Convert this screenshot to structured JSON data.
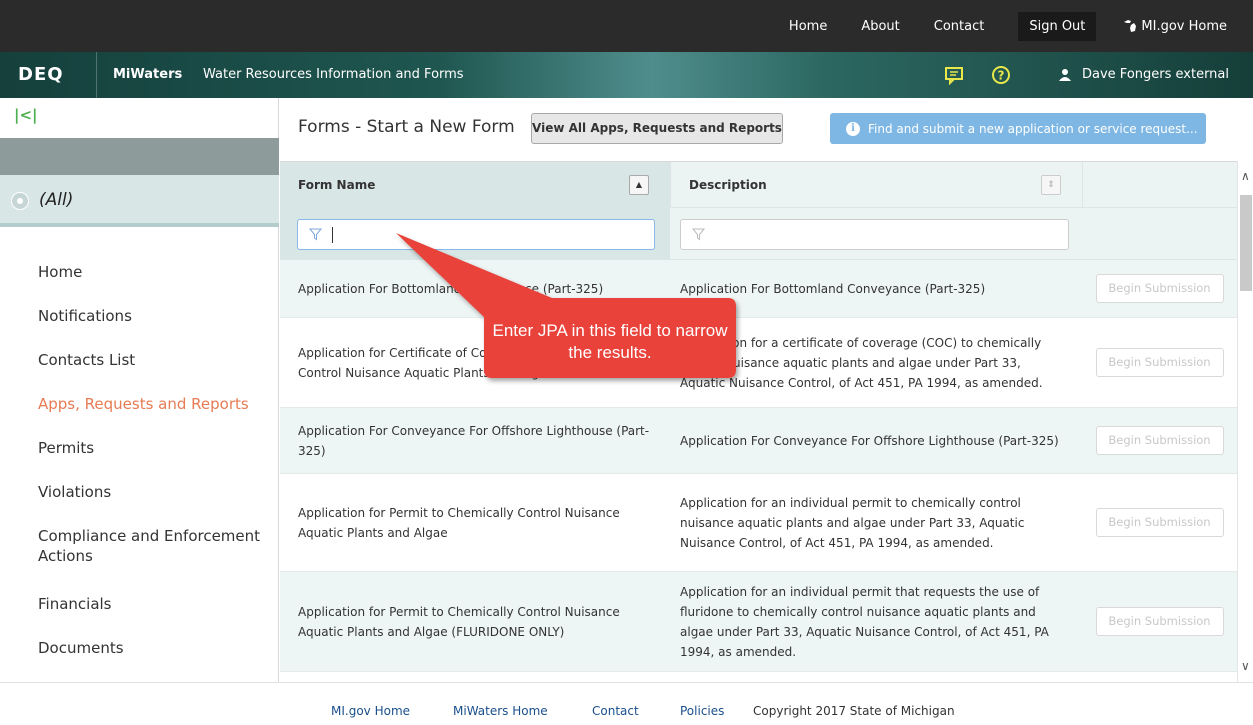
{
  "topnav": {
    "home": "Home",
    "about": "About",
    "contact": "Contact",
    "signout": "Sign Out",
    "migov_home": "MI.gov Home"
  },
  "header": {
    "logo": "DEQ",
    "app_name": "MiWaters",
    "subtitle": "Water Resources Information and Forms",
    "user": "Dave Fongers external"
  },
  "sidebar": {
    "collapse_icon": "collapse-icon",
    "filter_label": "(All)",
    "items": [
      {
        "label": "Home"
      },
      {
        "label": "Notifications"
      },
      {
        "label": "Contacts List"
      },
      {
        "label": "Apps, Requests and Reports"
      },
      {
        "label": "Permits"
      },
      {
        "label": "Violations"
      },
      {
        "label": "Compliance and Enforcement Actions"
      },
      {
        "label": "Financials"
      },
      {
        "label": "Documents"
      }
    ],
    "active_index": 3,
    "active_color": "#e67b54"
  },
  "main": {
    "title": "Forms - Start a New Form",
    "view_all_button": "View All Apps, Requests and Reports",
    "find_button": "Find and submit a new application or service request...",
    "accent_color": "#7eb7e4"
  },
  "table": {
    "columns": [
      "Form Name",
      "Description"
    ],
    "begin_label": "Begin Submission",
    "rows": [
      {
        "name": "Application For Bottomland Conveyance (Part-325)",
        "description": "Application For Bottomland Conveyance (Part-325)"
      },
      {
        "name": "Application for Certificate of Coverage to Chemically Control Nuisance Aquatic Plants and Algae",
        "description": "Application for a certificate of coverage (COC) to chemically control nuisance aquatic plants and algae under Part 33, Aquatic Nuisance Control, of Act 451, PA 1994, as amended."
      },
      {
        "name": "Application For Conveyance For Offshore Lighthouse (Part-325)",
        "description": "Application For Conveyance For Offshore Lighthouse (Part-325)"
      },
      {
        "name": "Application for Permit to Chemically Control Nuisance Aquatic Plants and Algae",
        "description": "Application for an individual permit to chemically control nuisance aquatic plants and algae under Part 33, Aquatic Nuisance Control, of Act 451, PA 1994, as amended."
      },
      {
        "name": "Application for Permit to Chemically Control Nuisance Aquatic Plants and Algae (FLURIDONE ONLY)",
        "description": "Application for an individual permit that requests the use of fluridone to chemically control nuisance aquatic plants and algae under Part 33, Aquatic Nuisance Control, of Act 451, PA 1994, as amended."
      }
    ]
  },
  "callout": {
    "text": "Enter JPA in this field to narrow the results.",
    "color": "#e8433a"
  },
  "footer": {
    "migov": "MI.gov Home",
    "miwaters": "MiWaters Home",
    "contact": "Contact",
    "policies": "Policies",
    "copyright": "Copyright 2017 State of Michigan"
  }
}
